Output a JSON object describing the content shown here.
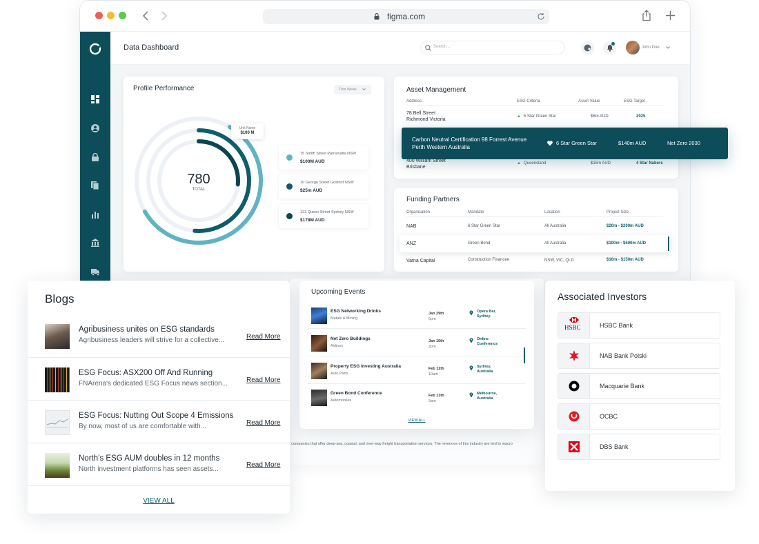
{
  "browser": {
    "url": "figma.com"
  },
  "app": {
    "title": "Data Dashboard",
    "search_placeholder": "Search...",
    "user_name": "John Doe"
  },
  "profile": {
    "title": "Profile Performance",
    "filter": "This Week",
    "total_value": "780",
    "total_label": "TOTAL",
    "tooltip_label": "Unit Name",
    "tooltip_value": "$100 M",
    "legend": [
      {
        "address": "75 Smith Street Parramatta NSW",
        "value": "$100M AUD",
        "color": "#5fb3c4"
      },
      {
        "address": "10 George Street Gosford NSW",
        "value": "$25m AUD",
        "color": "#0d5d6b"
      },
      {
        "address": "123 Queen Street Sydney NSW",
        "value": "$178M AUD",
        "color": "#0a4650"
      }
    ]
  },
  "assets": {
    "title": "Asset Management",
    "headers": [
      "Address",
      "ESG Criteria",
      "Asset Value",
      "ESG Target"
    ],
    "rows": [
      {
        "address": "78 Bell Street",
        "address2": "Richmond Victoria",
        "criteria": "5 Star Green Star",
        "value": "$6m AUD",
        "target": "2025"
      },
      {
        "address": "400 William Street",
        "address2": "Brisbane",
        "criteria": "Queensland",
        "value": "$15m AUD",
        "target": "4 Star Nabers"
      }
    ],
    "highlight": {
      "address": "Carbon Neutral Certification 98 Forrest Avenue Perth Western Australia",
      "criteria": "6 Star Green Star",
      "value": "$140m AUD",
      "target": "Net Zero 2030"
    }
  },
  "funding": {
    "title": "Funding Partners",
    "headers": [
      "Organisation",
      "Mandate",
      "Location",
      "Project Size"
    ],
    "rows": [
      {
        "org": "NAB",
        "mandate": "6 Star Green Star",
        "location": "All Australia",
        "size": "$20m - $200m AUD"
      },
      {
        "org": "ANZ",
        "mandate": "Green Bond",
        "location": "All Australia",
        "size": "$100m - $500m AUD"
      },
      {
        "org": "Vatna Capital",
        "mandate": "Construction Financee",
        "location": "NSW, VIC, QLD",
        "size": "$10m - $150m AUD"
      }
    ]
  },
  "blogs": {
    "title": "Blogs",
    "read_more": "Read More",
    "view_all": "VIEW ALL",
    "items": [
      {
        "title": "Agribusiness unites on ESG standards",
        "excerpt": "Agribusiness leaders will strive for a collective..."
      },
      {
        "title": "ESG Focus: ASX200 Off And Running",
        "excerpt": "FNArena's dedicated ESG Focus news section..."
      },
      {
        "title": "ESG Focus: Nutting Out Scope 4 Emissions",
        "excerpt": "By now, most of us are comfortable with..."
      },
      {
        "title": "North’s ESG AUM doubles in 12 months",
        "excerpt": "North investment platforms has seen assets..."
      }
    ]
  },
  "events": {
    "title": "Upcoming Events",
    "view_all": "VIEW ALL",
    "items": [
      {
        "name": "ESG Networking Drinks",
        "sub": "Metals & Mining",
        "date": "Jan 29th",
        "time": "6pm",
        "loc": "Opera Bar,",
        "loc2": "Sydney"
      },
      {
        "name": "Net Zero Buildings",
        "sub": "Airlines",
        "date": "Jan 10th",
        "time": "2pm",
        "loc": "Online",
        "loc2": "Conference"
      },
      {
        "name": "Property ESG Investing Australia",
        "sub": "Auto Parts",
        "date": "Feb 12th",
        "time": "10am",
        "loc": "Sydney,",
        "loc2": "Australia"
      },
      {
        "name": "Green Bond Conference",
        "sub": "Automobiles",
        "date": "Feb 13th",
        "time": "9am",
        "loc": "Melbourne,",
        "loc2": "Australia"
      }
    ]
  },
  "footer_text": "companies that offer deep-sea, coastal, and river-way freight transportation services. The revenues of this industry are tied to macro",
  "investors": {
    "title": "Associated Investors",
    "items": [
      {
        "name": "HSBC Bank",
        "logo_text": "HSBC"
      },
      {
        "name": "NAB Bank Polski"
      },
      {
        "name": "Macquarie Bank"
      },
      {
        "name": "OCBC"
      },
      {
        "name": "DBS Bank"
      }
    ]
  }
}
